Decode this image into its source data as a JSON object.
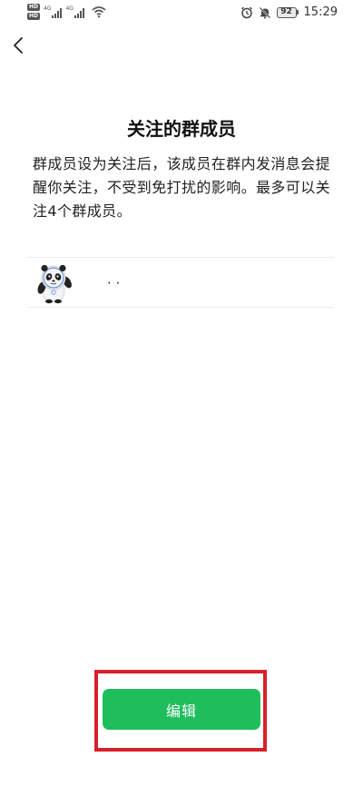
{
  "status_bar": {
    "hd1": "HD",
    "hd2": "HD",
    "net1": "4G",
    "net2": "4G",
    "battery": "92",
    "time": "15:29"
  },
  "nav": {
    "back_icon": "chevron-left-icon"
  },
  "header": {
    "title": "关注的群成员",
    "description": "群成员设为关注后，该成员在群内发消息会提醒你关注，不受到免打扰的影响。最多可以关注4个群成员。"
  },
  "members": [
    {
      "name": "· ·",
      "avatar": "panda-mascot-avatar"
    }
  ],
  "footer": {
    "edit_label": "编辑"
  },
  "colors": {
    "accent": "#1ebe5d",
    "highlight": "#d7202b"
  }
}
